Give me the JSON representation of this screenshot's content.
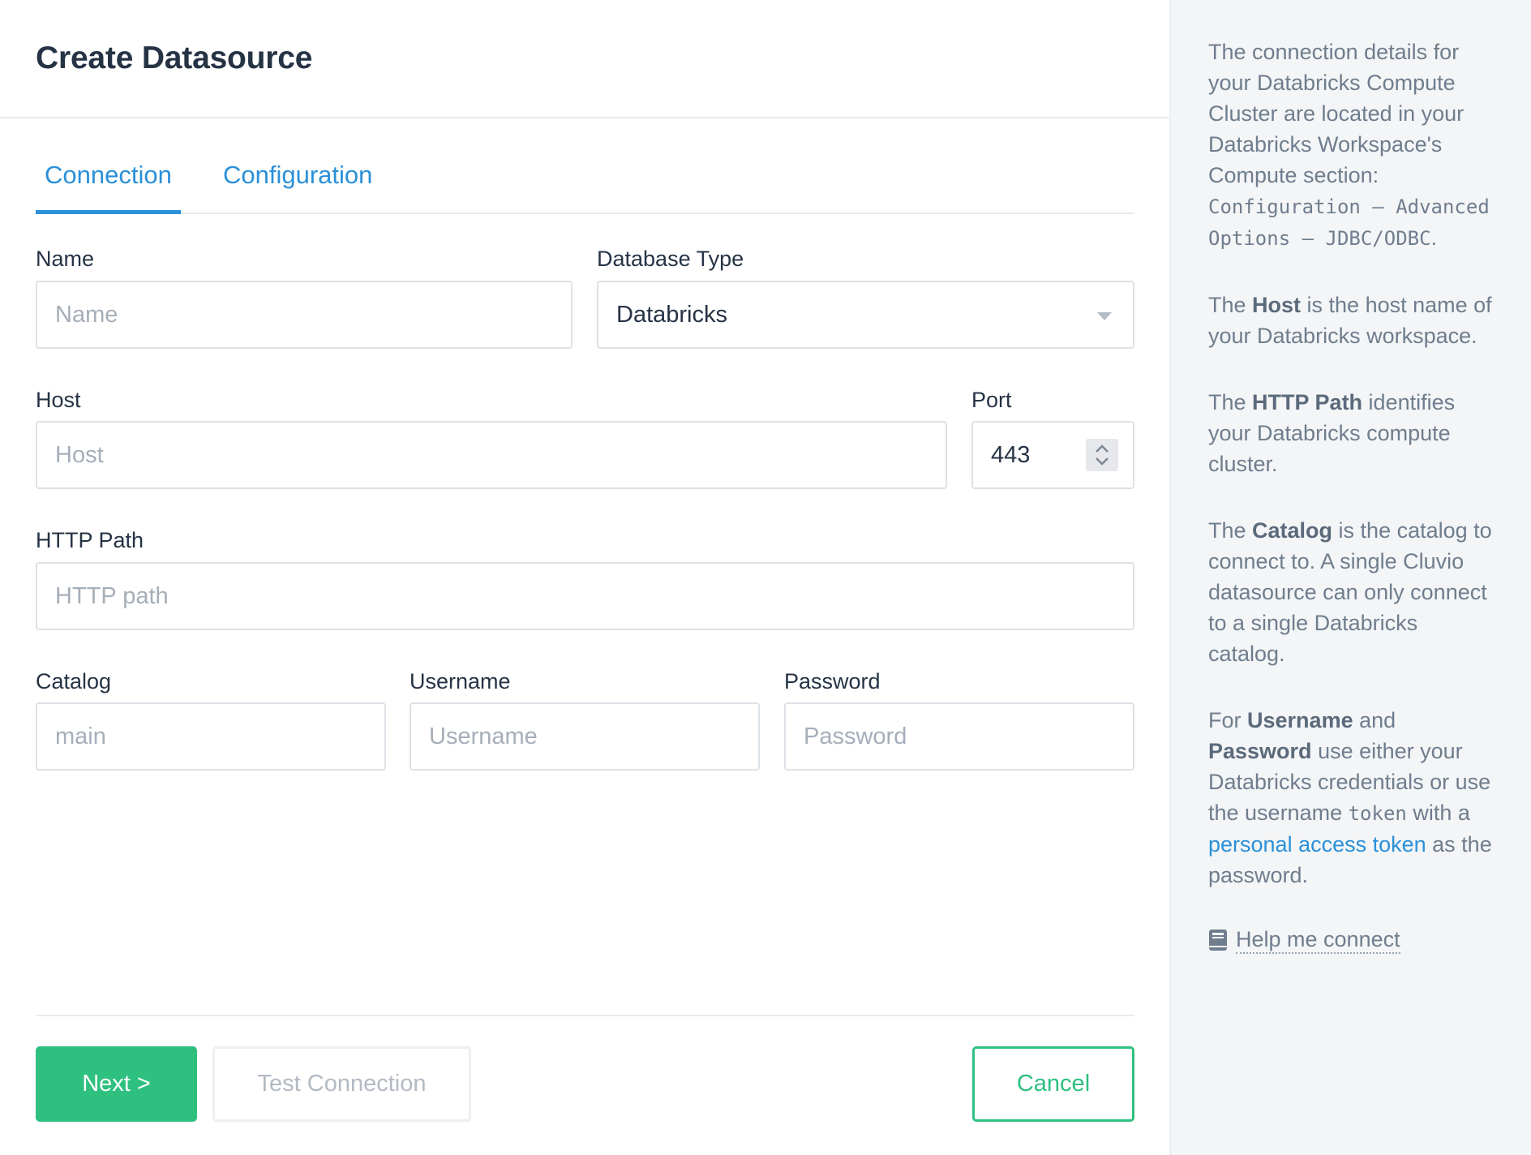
{
  "header": {
    "title": "Create Datasource"
  },
  "tabs": [
    {
      "label": "Connection",
      "active": true
    },
    {
      "label": "Configuration",
      "active": false
    }
  ],
  "form": {
    "name": {
      "label": "Name",
      "placeholder": "Name",
      "value": ""
    },
    "database_type": {
      "label": "Database Type",
      "value": "Databricks"
    },
    "host": {
      "label": "Host",
      "placeholder": "Host",
      "value": ""
    },
    "port": {
      "label": "Port",
      "value": "443"
    },
    "http_path": {
      "label": "HTTP Path",
      "placeholder": "HTTP path",
      "value": ""
    },
    "catalog": {
      "label": "Catalog",
      "placeholder": "main",
      "value": ""
    },
    "username": {
      "label": "Username",
      "placeholder": "Username",
      "value": ""
    },
    "password": {
      "label": "Password",
      "placeholder": "Password",
      "value": ""
    }
  },
  "buttons": {
    "next": "Next >",
    "test": "Test Connection",
    "cancel": "Cancel"
  },
  "help": {
    "p1_text": "The connection details for your Databricks Compute Cluster are located in your Databricks Workspace's Compute section: ",
    "p1_code": "Configuration – Advanced Options – JDBC/ODBC",
    "p1_end": ".",
    "p2_pre": "The ",
    "p2_bold": "Host",
    "p2_post": " is the host name of your Databricks workspace.",
    "p3_pre": "The ",
    "p3_bold": "HTTP Path",
    "p3_post": " identifies your Databricks compute cluster.",
    "p4_pre": "The ",
    "p4_bold": "Catalog",
    "p4_post": " is the catalog to connect to. A single Cluvio datasource can only connect to a single Databricks catalog.",
    "p5_pre": "For ",
    "p5_bold1": "Username",
    "p5_mid": " and ",
    "p5_bold2": "Password",
    "p5_mid2": " use either your Databricks credentials or use the username ",
    "p5_code": "token",
    "p5_mid3": " with a ",
    "p5_link": "personal access token",
    "p5_post": " as the password.",
    "help_link": "Help me connect",
    "help_icon": "book-icon"
  },
  "colors": {
    "accent_blue": "#2a90d8",
    "accent_green": "#2ec07f",
    "title": "#253345"
  }
}
